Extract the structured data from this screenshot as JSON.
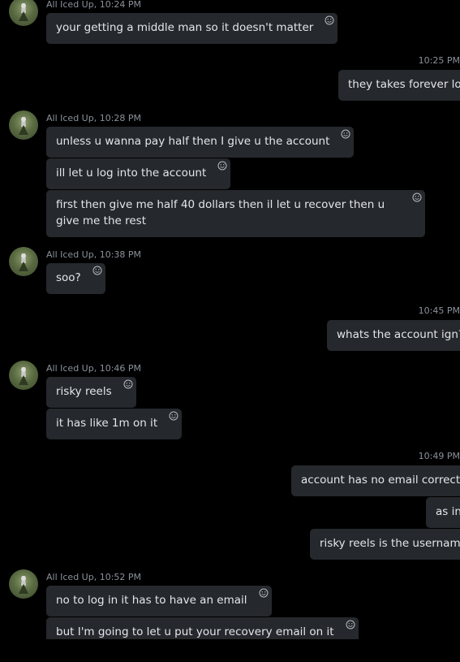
{
  "sender_name": "All Iced Up",
  "groups": [
    {
      "meta": "All Iced Up, 10:24 PM",
      "messages": [
        "your getting a middle man so it doesn't matter"
      ]
    },
    {
      "time": "10:25 PM",
      "messages": [
        "they takes forever lol"
      ]
    },
    {
      "meta": "All Iced Up, 10:28 PM",
      "messages": [
        "unless u wanna pay half then I give u the account",
        "ill let u log into the account",
        "first then give me half 40 dollars then il let u recover then u give me the rest"
      ]
    },
    {
      "meta": "All Iced Up, 10:38 PM",
      "messages": [
        "soo?"
      ]
    },
    {
      "time": "10:45 PM",
      "messages": [
        "whats the account ign?"
      ]
    },
    {
      "meta": "All Iced Up, 10:46 PM",
      "messages": [
        "risky reels",
        "it has like 1m on it"
      ]
    },
    {
      "time": "10:49 PM",
      "messages": [
        "account has no email correct?",
        "as in",
        "risky reels is the username"
      ]
    },
    {
      "meta": "All Iced Up, 10:52 PM",
      "messages": [
        "no to log in it has to have an email",
        "but I'm going to let u put your recovery email on it"
      ]
    }
  ],
  "icons": {
    "reaction": "smiley-face-icon",
    "avatar": "user-avatar"
  },
  "colors": {
    "background": "#000000",
    "bubble": "#25282c",
    "text": "#e3e6ea",
    "meta": "#8b9199"
  }
}
